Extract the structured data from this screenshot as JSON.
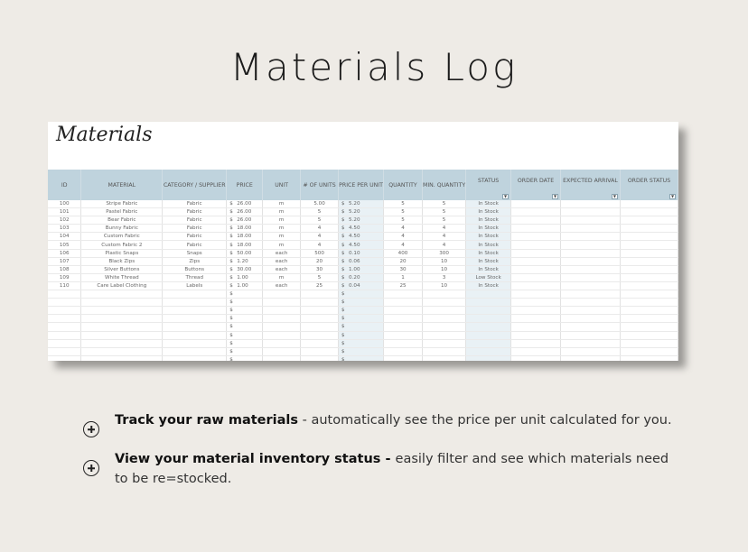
{
  "page_title": "Materials Log",
  "sheet": {
    "title": "Materials",
    "columns": [
      "ID",
      "MATERIAL",
      "CATEGORY / SUPPLIER",
      "PRICE",
      "UNIT",
      "# OF UNITS",
      "PRICE PER UNIT",
      "QUANTITY",
      "MIN. QUANTITY",
      "STATUS",
      "ORDER DATE",
      "EXPECTED ARRIVAL",
      "ORDER STATUS"
    ],
    "currency_symbol": "$",
    "rows": [
      {
        "id": "100",
        "material": "Stripe Fabric",
        "category": "Fabric",
        "price": "26.00",
        "unit": "m",
        "units": "5.00",
        "ppu": "5.20",
        "qty": "5",
        "min": "5",
        "status": "In Stock"
      },
      {
        "id": "101",
        "material": "Pastel Fabric",
        "category": "Fabric",
        "price": "26.00",
        "unit": "m",
        "units": "5",
        "ppu": "5.20",
        "qty": "5",
        "min": "5",
        "status": "In Stock"
      },
      {
        "id": "102",
        "material": "Bear Fabric",
        "category": "Fabric",
        "price": "26.00",
        "unit": "m",
        "units": "5",
        "ppu": "5.20",
        "qty": "5",
        "min": "5",
        "status": "In Stock"
      },
      {
        "id": "103",
        "material": "Bunny Fabric",
        "category": "Fabric",
        "price": "18.00",
        "unit": "m",
        "units": "4",
        "ppu": "4.50",
        "qty": "4",
        "min": "4",
        "status": "In Stock"
      },
      {
        "id": "104",
        "material": "Custom Fabric",
        "category": "Fabric",
        "price": "18.00",
        "unit": "m",
        "units": "4",
        "ppu": "4.50",
        "qty": "4",
        "min": "4",
        "status": "In Stock"
      },
      {
        "id": "105",
        "material": "Custom Fabric 2",
        "category": "Fabric",
        "price": "18.00",
        "unit": "m",
        "units": "4",
        "ppu": "4.50",
        "qty": "4",
        "min": "4",
        "status": "In Stock"
      },
      {
        "id": "106",
        "material": "Plastic Snaps",
        "category": "Snaps",
        "price": "50.00",
        "unit": "each",
        "units": "500",
        "ppu": "0.10",
        "qty": "400",
        "min": "300",
        "status": "In Stock"
      },
      {
        "id": "107",
        "material": "Black Zips",
        "category": "Zips",
        "price": "1.20",
        "unit": "each",
        "units": "20",
        "ppu": "0.06",
        "qty": "20",
        "min": "10",
        "status": "In Stock"
      },
      {
        "id": "108",
        "material": "Silver Buttons",
        "category": "Buttons",
        "price": "30.00",
        "unit": "each",
        "units": "30",
        "ppu": "1.00",
        "qty": "30",
        "min": "10",
        "status": "In Stock"
      },
      {
        "id": "109",
        "material": "White Thread",
        "category": "Thread",
        "price": "1.00",
        "unit": "m",
        "units": "5",
        "ppu": "0.20",
        "qty": "1",
        "min": "3",
        "status": "Low Stock"
      },
      {
        "id": "110",
        "material": "Care Label Clothing",
        "category": "Labels",
        "price": "1.00",
        "unit": "each",
        "units": "25",
        "ppu": "0.04",
        "qty": "25",
        "min": "10",
        "status": "In Stock"
      }
    ],
    "empty_rows": 10
  },
  "features": [
    {
      "bold": "Track your raw materials",
      "rest": " - automatically see the price per unit calculated for you."
    },
    {
      "bold": "View your material inventory status - ",
      "rest": "easily filter and see which materials need to be re=stocked."
    }
  ],
  "colors": {
    "header_bg": "#bfd3dd",
    "calc_col_bg": "#e9f1f5",
    "background": "#eeebe6"
  }
}
